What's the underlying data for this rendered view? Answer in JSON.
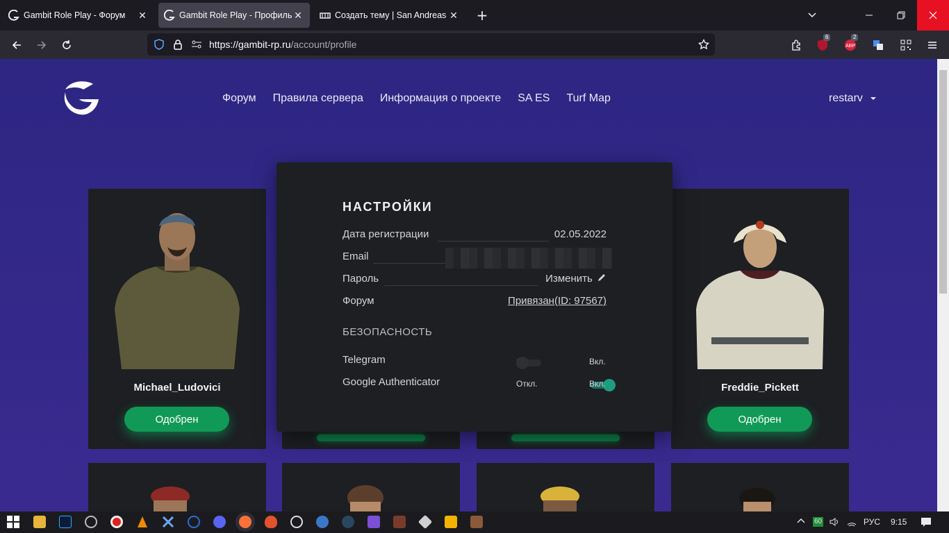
{
  "browser": {
    "tabs": [
      {
        "title": "Gambit Role Play - Форум",
        "active": false,
        "icon": "gambit-logo-icon"
      },
      {
        "title": "Gambit Role Play - Профиль UC",
        "active": true,
        "icon": "gambit-logo-icon"
      },
      {
        "title": "Создать тему | San Andreas Em",
        "active": false,
        "icon": "forum-icon"
      }
    ],
    "new_tab": "+",
    "url_host": "https://gambit-rp.ru",
    "url_path": "/account/profile",
    "ext_badge_1": "6",
    "ext_badge_2": "2"
  },
  "site": {
    "nav": [
      "Форум",
      "Правила сервера",
      "Информация о проекте",
      "SA ES",
      "Turf Map"
    ],
    "username": "restarv"
  },
  "characters": [
    {
      "name": "Michael_Ludovici",
      "status": "Одобрен"
    },
    {
      "name": "Freddie_Pickett",
      "status": "Одобрен"
    }
  ],
  "settings": {
    "title": "НАСТРОЙКИ",
    "reg_label": "Дата регистрации",
    "reg_value": "02.05.2022",
    "email_label": "Email",
    "password_label": "Пароль",
    "password_action": "Изменить",
    "forum_label": "Форум",
    "forum_value": "Привязан(ID: 97567)",
    "security_title": "БЕЗОПАСНОСТЬ",
    "toggle_off": "Откл.",
    "toggle_on": "Вкл.",
    "telegram_label": "Telegram",
    "telegram_enabled": false,
    "ga_label": "Google Authenticator",
    "ga_enabled": true
  },
  "taskbar": {
    "lang": "РУС",
    "time": "9:15",
    "battery": "60"
  },
  "colors": {
    "page_bg": "#2d2682",
    "card_bg": "#1d1f22",
    "accent_green": "#119a57",
    "toggle_on": "#1e9c7f"
  }
}
